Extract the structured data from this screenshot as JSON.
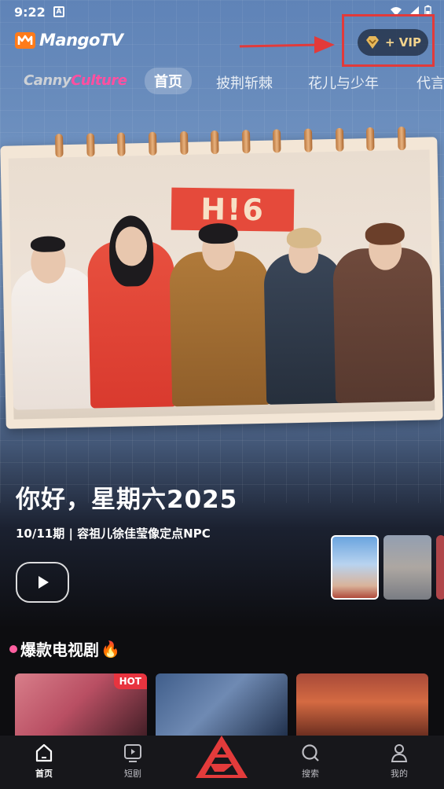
{
  "status_bar": {
    "time": "9:22",
    "badge": "A"
  },
  "header": {
    "logo_text": "MangoTV",
    "vip_label": "+ VIP",
    "annotation_color": "#e23a3a",
    "vip_text_color": "#f2d38d"
  },
  "tabs": {
    "brand_part1": "Canny",
    "brand_part2": "Culture",
    "items": [
      {
        "label": "首页",
        "active": true
      },
      {
        "label": "披荆斩棘",
        "active": false
      },
      {
        "label": "花儿与少年",
        "active": false
      },
      {
        "label": "代言",
        "active": false
      }
    ]
  },
  "hero": {
    "poster_badge": "H!6",
    "title": "你好，星期六2025",
    "subtitle": "10/11期 | 容祖儿徐佳莹像定点NPC",
    "play_icon": "play-icon"
  },
  "section": {
    "title": "爆款电视剧",
    "emoji": "🔥",
    "cards": [
      {
        "badge": "HOT"
      },
      {
        "badge": ""
      },
      {
        "badge": ""
      }
    ]
  },
  "bottom_nav": {
    "items": [
      {
        "label": "首页",
        "icon": "home-icon",
        "active": true
      },
      {
        "label": "短剧",
        "icon": "short-drama-icon",
        "active": false
      },
      {
        "label": "搜索",
        "icon": "search-icon",
        "active": false
      },
      {
        "label": "我的",
        "icon": "profile-icon",
        "active": false
      }
    ],
    "center_icon": "mango-logo-icon"
  }
}
